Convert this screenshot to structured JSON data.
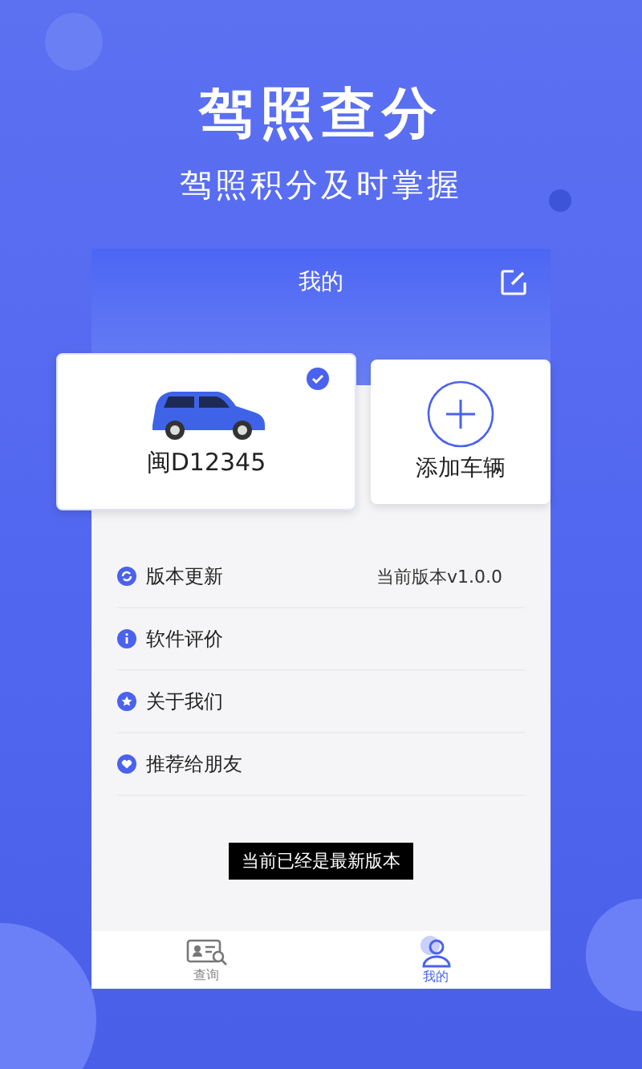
{
  "headline": {
    "title": "驾照查分",
    "subtitle": "驾照积分及时掌握"
  },
  "screen": {
    "title": "我的",
    "vehicles": [
      {
        "kind": "car",
        "plate": "闽D12345",
        "selected": true
      },
      {
        "kind": "add",
        "label": "添加车辆",
        "selected": false
      }
    ],
    "menu": [
      {
        "kind": "update",
        "label": "版本更新",
        "value": "当前版本v1.0.0"
      },
      {
        "kind": "info",
        "label": "软件评价"
      },
      {
        "kind": "about",
        "label": "关于我们"
      },
      {
        "kind": "share",
        "label": "推荐给朋友"
      }
    ],
    "toast": "当前已经是最新版本",
    "tabs": [
      {
        "kind": "query",
        "label": "查询",
        "selected": false
      },
      {
        "kind": "me",
        "label": "我的",
        "selected": true
      }
    ]
  }
}
